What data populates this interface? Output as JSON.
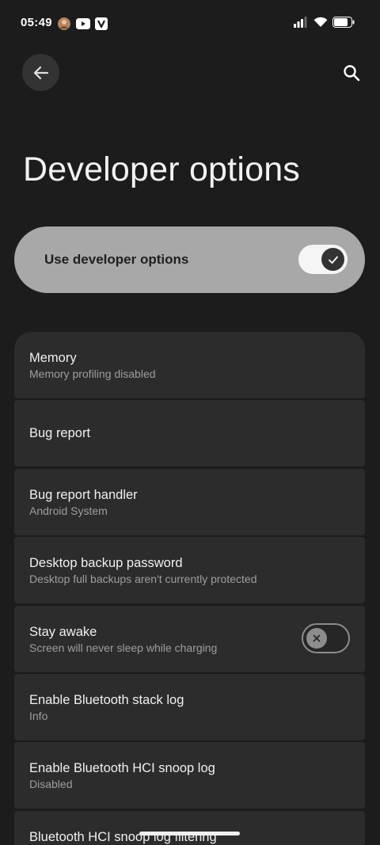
{
  "status_bar": {
    "time": "05:49",
    "left_icons": [
      "avatar-icon",
      "youtube-icon",
      "v-app-icon"
    ],
    "right_icons": [
      "signal-icon",
      "wifi-icon",
      "battery-icon"
    ]
  },
  "header": {
    "back_icon": "arrow-back-icon",
    "search_icon": "search-icon",
    "title": "Developer options"
  },
  "master_switch": {
    "label": "Use developer options",
    "enabled": true
  },
  "settings": [
    {
      "title": "Memory",
      "subtitle": "Memory profiling disabled"
    },
    {
      "title": "Bug report",
      "subtitle": ""
    },
    {
      "title": "Bug report handler",
      "subtitle": "Android System"
    },
    {
      "title": "Desktop backup password",
      "subtitle": "Desktop full backups aren't currently protected"
    },
    {
      "title": "Stay awake",
      "subtitle": "Screen will never sleep while charging",
      "toggle": false
    },
    {
      "title": "Enable Bluetooth stack log",
      "subtitle": "Info"
    },
    {
      "title": "Enable Bluetooth HCI snoop log",
      "subtitle": "Disabled"
    },
    {
      "title": "Bluetooth HCI snoop log filtering",
      "subtitle": ""
    }
  ],
  "colors": {
    "background": "#1c1c1c",
    "card": "#2c2c2c",
    "master_card": "#a8a8a8",
    "secondary_text": "#9e9e9e"
  }
}
